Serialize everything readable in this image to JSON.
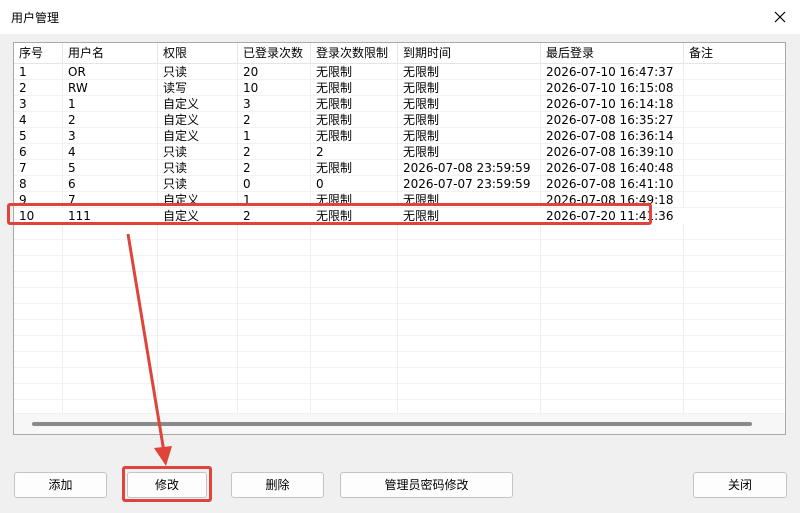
{
  "window": {
    "title": "用户管理"
  },
  "columns": [
    "序号",
    "用户名",
    "权限",
    "已登录次数",
    "登录次数限制",
    "到期时间",
    "最后登录",
    "备注"
  ],
  "rows": [
    [
      "1",
      "OR",
      "只读",
      "20",
      "无限制",
      "无限制",
      "2026-07-10 16:47:37",
      ""
    ],
    [
      "2",
      "RW",
      "读写",
      "10",
      "无限制",
      "无限制",
      "2026-07-10 16:15:08",
      ""
    ],
    [
      "3",
      "1",
      "自定义",
      "3",
      "无限制",
      "无限制",
      "2026-07-10 16:14:18",
      ""
    ],
    [
      "4",
      "2",
      "自定义",
      "2",
      "无限制",
      "无限制",
      "2026-07-08 16:35:27",
      ""
    ],
    [
      "5",
      "3",
      "自定义",
      "1",
      "无限制",
      "无限制",
      "2026-07-08 16:36:14",
      ""
    ],
    [
      "6",
      "4",
      "只读",
      "2",
      "2",
      "无限制",
      "2026-07-08 16:39:10",
      ""
    ],
    [
      "7",
      "5",
      "只读",
      "2",
      "无限制",
      "2026-07-08 23:59:59",
      "2026-07-08 16:40:48",
      ""
    ],
    [
      "8",
      "6",
      "只读",
      "0",
      "0",
      "2026-07-07 23:59:59",
      "2026-07-08 16:41:10",
      ""
    ],
    [
      "9",
      "7",
      "自定义",
      "1",
      "无限制",
      "无限制",
      "2026-07-08 16:49:18",
      ""
    ],
    [
      "10",
      "111",
      "自定义",
      "2",
      "无限制",
      "无限制",
      "2026-07-20 11:41:36",
      ""
    ]
  ],
  "buttons": {
    "add": "添加",
    "modify": "修改",
    "delete": "删除",
    "admin_password": "管理员密码修改",
    "close": "关闭"
  },
  "colors": {
    "highlight": "#e0433a"
  },
  "icons": {
    "close": "close-icon"
  }
}
